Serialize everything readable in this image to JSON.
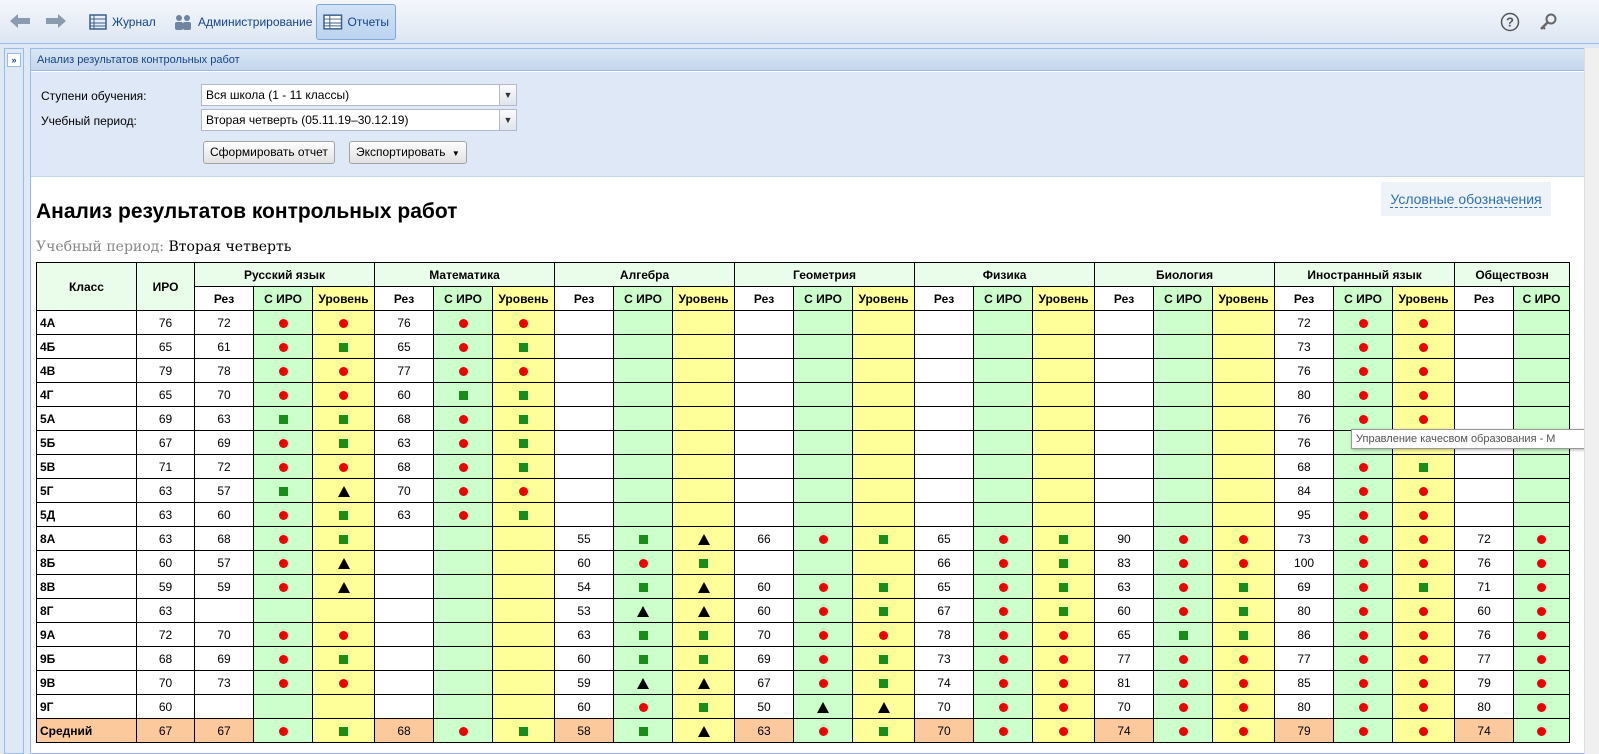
{
  "toolbar": {
    "journal_label": "Журнал",
    "admin_label": "Администрирование",
    "reports_label": "Отчеты",
    "icons": [
      "back-arrow-icon",
      "forward-arrow-icon",
      "journal-icon",
      "admin-icon",
      "reports-icon",
      "help-icon",
      "key-icon"
    ]
  },
  "panel": {
    "title": "Анализ результатов контрольных работ"
  },
  "form": {
    "level_label": "Ступени обучения:",
    "level_value": "Вся школа (1 - 11 классы)",
    "period_label": "Учебный период:",
    "period_value": "Вторая четверть (05.11.19–30.12.19)",
    "generate_button": "Сформировать отчет",
    "export_button": "Экспортировать"
  },
  "report": {
    "legend_link": "Условные обозначения",
    "title": "Анализ результатов контрольных работ",
    "period_label": "Учебный период:",
    "period_value": "Вторая четверть",
    "tooltip": "Управление качесвом образования - М",
    "head_class": "Класс",
    "head_iro": "ИРО",
    "subjects": [
      "Русский язык",
      "Математика",
      "Алгебра",
      "Геометрия",
      "Физика",
      "Биология",
      "Иностранный язык",
      "Обществозн"
    ],
    "sub_headers": [
      "Рез",
      "С ИРО",
      "Уровень"
    ],
    "colors": {
      "header_bg": "#eafdea",
      "rez_bg": "#ffffff",
      "vs_iro_bg": "#ccffcc",
      "level_bg": "#ffff99",
      "avg_bg": "#fcc99c",
      "circle": "#ee0000",
      "square": "#1a8c1a",
      "triangle": "#000000"
    },
    "rows": [
      {
        "cls": "4А",
        "iro": "76",
        "cells": [
          [
            "72",
            "c",
            "c"
          ],
          [
            "76",
            "c",
            "c"
          ],
          [
            "",
            "",
            ""
          ],
          [
            "",
            "",
            ""
          ],
          [
            "",
            "",
            ""
          ],
          [
            "",
            "",
            ""
          ],
          [
            "72",
            "c",
            "c"
          ],
          [
            "",
            ""
          ]
        ]
      },
      {
        "cls": "4Б",
        "iro": "65",
        "cells": [
          [
            "61",
            "c",
            "s"
          ],
          [
            "65",
            "c",
            "s"
          ],
          [
            "",
            "",
            ""
          ],
          [
            "",
            "",
            ""
          ],
          [
            "",
            "",
            ""
          ],
          [
            "",
            "",
            ""
          ],
          [
            "73",
            "c",
            "c"
          ],
          [
            "",
            ""
          ]
        ]
      },
      {
        "cls": "4В",
        "iro": "79",
        "cells": [
          [
            "78",
            "c",
            "c"
          ],
          [
            "77",
            "c",
            "c"
          ],
          [
            "",
            "",
            ""
          ],
          [
            "",
            "",
            ""
          ],
          [
            "",
            "",
            ""
          ],
          [
            "",
            "",
            ""
          ],
          [
            "76",
            "c",
            "c"
          ],
          [
            "",
            ""
          ]
        ]
      },
      {
        "cls": "4Г",
        "iro": "65",
        "cells": [
          [
            "70",
            "c",
            "c"
          ],
          [
            "60",
            "s",
            "s"
          ],
          [
            "",
            "",
            ""
          ],
          [
            "",
            "",
            ""
          ],
          [
            "",
            "",
            ""
          ],
          [
            "",
            "",
            ""
          ],
          [
            "80",
            "c",
            "c"
          ],
          [
            "",
            ""
          ]
        ]
      },
      {
        "cls": "5А",
        "iro": "69",
        "cells": [
          [
            "63",
            "s",
            "s"
          ],
          [
            "68",
            "c",
            "s"
          ],
          [
            "",
            "",
            ""
          ],
          [
            "",
            "",
            ""
          ],
          [
            "",
            "",
            ""
          ],
          [
            "",
            "",
            ""
          ],
          [
            "76",
            "c",
            "c"
          ],
          [
            "",
            ""
          ]
        ]
      },
      {
        "cls": "5Б",
        "iro": "67",
        "cells": [
          [
            "69",
            "c",
            "s"
          ],
          [
            "63",
            "c",
            "s"
          ],
          [
            "",
            "",
            ""
          ],
          [
            "",
            "",
            ""
          ],
          [
            "",
            "",
            ""
          ],
          [
            "",
            "",
            ""
          ],
          [
            "76",
            "c",
            "c"
          ],
          [
            "",
            ""
          ]
        ]
      },
      {
        "cls": "5В",
        "iro": "71",
        "cells": [
          [
            "72",
            "c",
            "c"
          ],
          [
            "68",
            "c",
            "s"
          ],
          [
            "",
            "",
            ""
          ],
          [
            "",
            "",
            ""
          ],
          [
            "",
            "",
            ""
          ],
          [
            "",
            "",
            ""
          ],
          [
            "68",
            "c",
            "s"
          ],
          [
            "",
            ""
          ]
        ]
      },
      {
        "cls": "5Г",
        "iro": "63",
        "cells": [
          [
            "57",
            "s",
            "t"
          ],
          [
            "70",
            "c",
            "c"
          ],
          [
            "",
            "",
            ""
          ],
          [
            "",
            "",
            ""
          ],
          [
            "",
            "",
            ""
          ],
          [
            "",
            "",
            ""
          ],
          [
            "84",
            "c",
            "c"
          ],
          [
            "",
            ""
          ]
        ]
      },
      {
        "cls": "5Д",
        "iro": "63",
        "cells": [
          [
            "60",
            "c",
            "s"
          ],
          [
            "63",
            "c",
            "s"
          ],
          [
            "",
            "",
            ""
          ],
          [
            "",
            "",
            ""
          ],
          [
            "",
            "",
            ""
          ],
          [
            "",
            "",
            ""
          ],
          [
            "95",
            "c",
            "c"
          ],
          [
            "",
            ""
          ]
        ]
      },
      {
        "cls": "8А",
        "iro": "63",
        "cells": [
          [
            "68",
            "c",
            "s"
          ],
          [
            "",
            "",
            ""
          ],
          [
            "55",
            "s",
            "t"
          ],
          [
            "66",
            "c",
            "s"
          ],
          [
            "65",
            "c",
            "s"
          ],
          [
            "90",
            "c",
            "c"
          ],
          [
            "73",
            "c",
            "c"
          ],
          [
            "72",
            "c"
          ]
        ]
      },
      {
        "cls": "8Б",
        "iro": "60",
        "cells": [
          [
            "57",
            "c",
            "t"
          ],
          [
            "",
            "",
            ""
          ],
          [
            "60",
            "c",
            "s"
          ],
          [
            "",
            "",
            ""
          ],
          [
            "66",
            "c",
            "s"
          ],
          [
            "83",
            "c",
            "c"
          ],
          [
            "100",
            "c",
            "c"
          ],
          [
            "76",
            "c"
          ]
        ]
      },
      {
        "cls": "8В",
        "iro": "59",
        "cells": [
          [
            "59",
            "c",
            "t"
          ],
          [
            "",
            "",
            ""
          ],
          [
            "54",
            "s",
            "t"
          ],
          [
            "60",
            "c",
            "s"
          ],
          [
            "65",
            "c",
            "s"
          ],
          [
            "63",
            "c",
            "s"
          ],
          [
            "69",
            "c",
            "s"
          ],
          [
            "71",
            "c"
          ]
        ]
      },
      {
        "cls": "8Г",
        "iro": "63",
        "cells": [
          [
            "",
            "",
            ""
          ],
          [
            "",
            "",
            ""
          ],
          [
            "53",
            "t",
            "t"
          ],
          [
            "60",
            "c",
            "s"
          ],
          [
            "67",
            "c",
            "s"
          ],
          [
            "60",
            "c",
            "s"
          ],
          [
            "80",
            "c",
            "c"
          ],
          [
            "60",
            "c"
          ]
        ]
      },
      {
        "cls": "9А",
        "iro": "72",
        "cells": [
          [
            "70",
            "c",
            "c"
          ],
          [
            "",
            "",
            ""
          ],
          [
            "63",
            "s",
            "s"
          ],
          [
            "70",
            "c",
            "c"
          ],
          [
            "78",
            "c",
            "c"
          ],
          [
            "65",
            "s",
            "s"
          ],
          [
            "86",
            "c",
            "c"
          ],
          [
            "76",
            "c"
          ]
        ]
      },
      {
        "cls": "9Б",
        "iro": "68",
        "cells": [
          [
            "69",
            "c",
            "s"
          ],
          [
            "",
            "",
            ""
          ],
          [
            "60",
            "s",
            "s"
          ],
          [
            "69",
            "c",
            "s"
          ],
          [
            "73",
            "c",
            "c"
          ],
          [
            "77",
            "c",
            "c"
          ],
          [
            "77",
            "c",
            "c"
          ],
          [
            "77",
            "c"
          ]
        ]
      },
      {
        "cls": "9В",
        "iro": "70",
        "cells": [
          [
            "73",
            "c",
            "c"
          ],
          [
            "",
            "",
            ""
          ],
          [
            "59",
            "t",
            "t"
          ],
          [
            "67",
            "c",
            "s"
          ],
          [
            "74",
            "c",
            "c"
          ],
          [
            "81",
            "c",
            "c"
          ],
          [
            "85",
            "c",
            "c"
          ],
          [
            "79",
            "c"
          ]
        ]
      },
      {
        "cls": "9Г",
        "iro": "60",
        "cells": [
          [
            "",
            "",
            ""
          ],
          [
            "",
            "",
            ""
          ],
          [
            "60",
            "c",
            "s"
          ],
          [
            "50",
            "t",
            "t"
          ],
          [
            "70",
            "c",
            "c"
          ],
          [
            "70",
            "c",
            "c"
          ],
          [
            "80",
            "c",
            "c"
          ],
          [
            "80",
            "c"
          ]
        ]
      },
      {
        "cls": "Средний",
        "iro": "67",
        "avg": true,
        "cells": [
          [
            "67",
            "c",
            "s"
          ],
          [
            "68",
            "c",
            "s"
          ],
          [
            "58",
            "s",
            "t"
          ],
          [
            "63",
            "c",
            "s"
          ],
          [
            "70",
            "c",
            "c"
          ],
          [
            "74",
            "c",
            "c"
          ],
          [
            "79",
            "c",
            "c"
          ],
          [
            "74",
            "c"
          ]
        ]
      }
    ]
  }
}
